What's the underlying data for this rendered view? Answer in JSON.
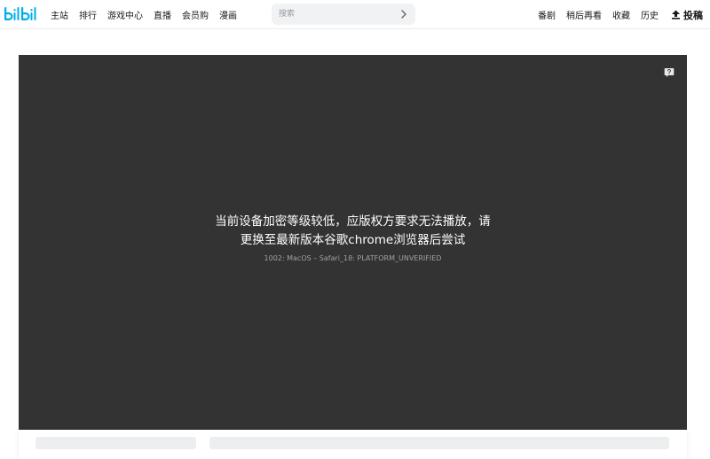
{
  "header": {
    "nav": [
      "主站",
      "排行",
      "游戏中心",
      "直播",
      "会员购",
      "漫画"
    ],
    "search_placeholder": "搜索",
    "right_nav": [
      "番剧",
      "稍后再看",
      "收藏",
      "历史"
    ],
    "upload_label": "投稿"
  },
  "player": {
    "error_line1": "当前设备加密等级较低，应版权方要求无法播放，请",
    "error_line2": "更换至最新版本谷歌chrome浏览器后尝试",
    "error_code": "1002: MacOS – Safari_18: PLATFORM_UNVERIFIED"
  },
  "colors": {
    "brand": "#00aeec",
    "player_bg": "#333333"
  },
  "icons": {
    "logo": "bilibili-logo",
    "search": "chevron-right-icon",
    "upload": "upload-icon",
    "feedback": "feedback-icon"
  }
}
